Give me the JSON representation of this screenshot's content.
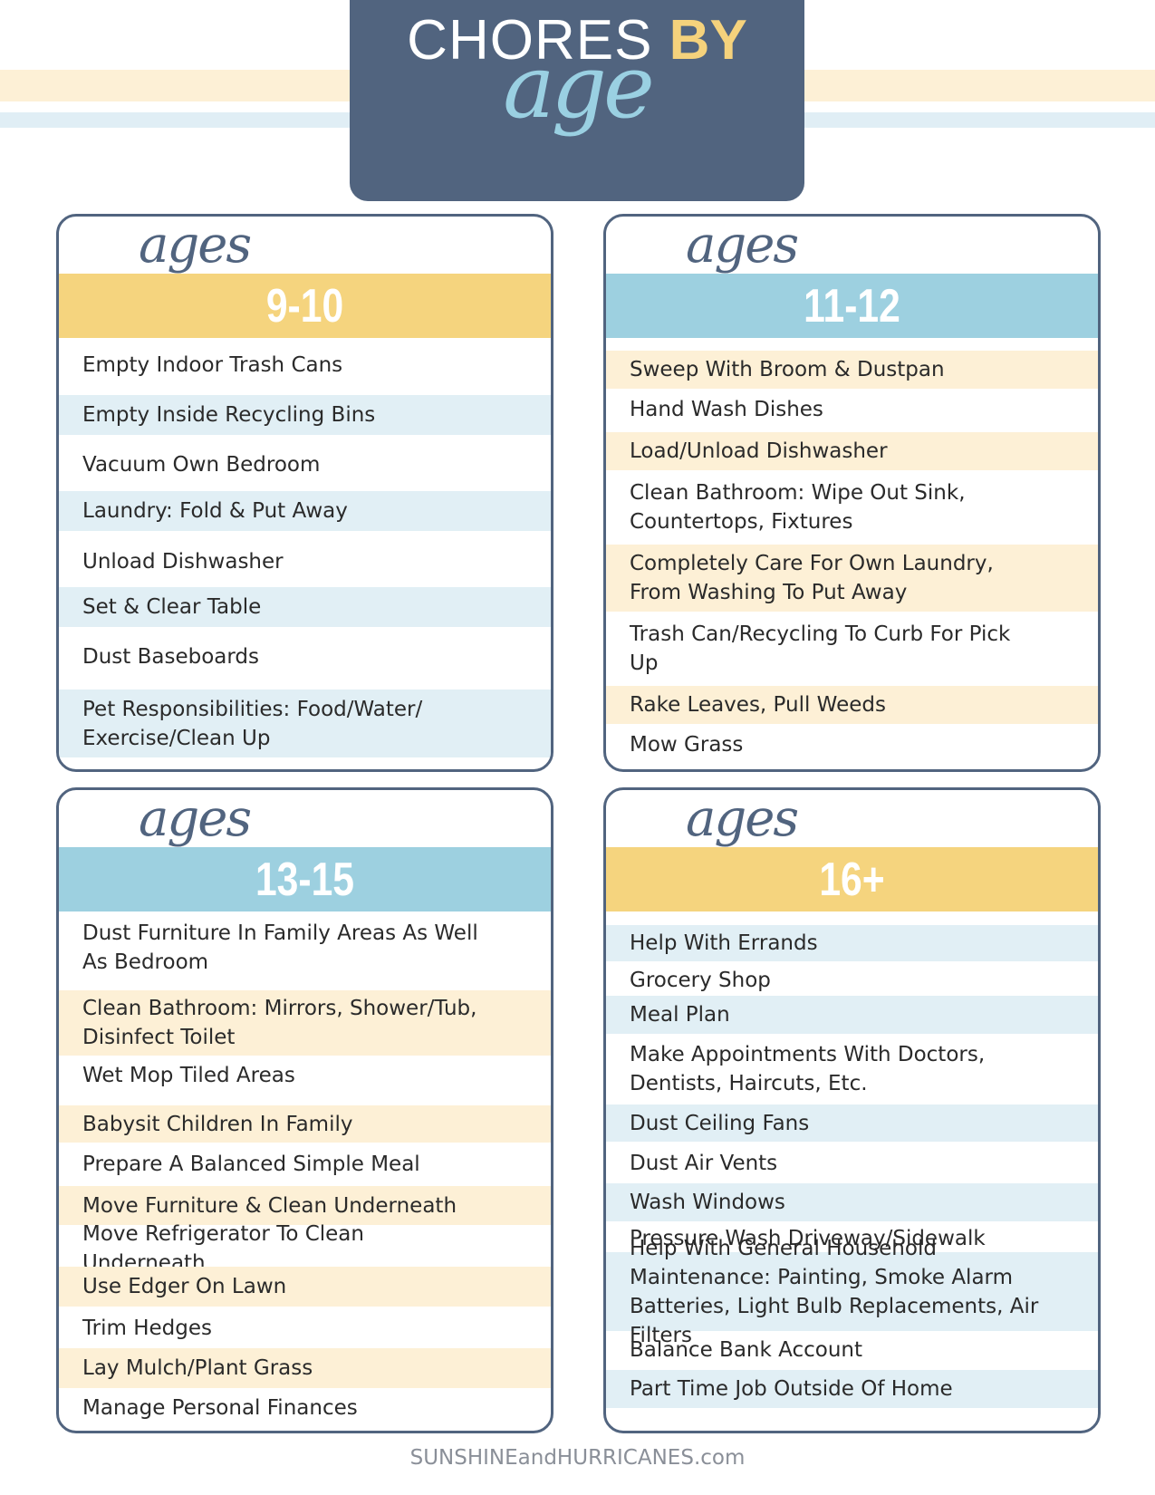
{
  "header": {
    "title_main": "CHORES",
    "title_accent": "BY",
    "title_script": "age"
  },
  "colors": {
    "navy": "#51647f",
    "yellow": "#f5d47e",
    "light_yellow": "#fdf0d6",
    "blue": "#9dd0e0",
    "light_blue": "#e1eff5",
    "script_blue": "#9ad0e2"
  },
  "cards": [
    {
      "label": "ages",
      "range": "9-10",
      "band_color": "yellow",
      "chores": [
        {
          "text": "Empty Indoor Trash Cans",
          "bg": "white"
        },
        {
          "text": "Empty Inside Recycling Bins",
          "bg": "blue"
        },
        {
          "text": "Vacuum Own Bedroom",
          "bg": "white"
        },
        {
          "text": "Laundry: Fold & Put Away",
          "bg": "blue"
        },
        {
          "text": "Unload Dishwasher",
          "bg": "white"
        },
        {
          "text": "Set & Clear Table",
          "bg": "blue"
        },
        {
          "text": "Dust Baseboards",
          "bg": "white"
        },
        {
          "text": "Pet Responsibilities: Food/Water/ Exercise/Clean Up",
          "bg": "blue"
        }
      ]
    },
    {
      "label": "ages",
      "range": "11-12",
      "band_color": "blue",
      "chores": [
        {
          "text": "Sweep With Broom & Dustpan",
          "bg": "yellow"
        },
        {
          "text": "Hand Wash Dishes",
          "bg": "white"
        },
        {
          "text": "Load/Unload Dishwasher",
          "bg": "yellow"
        },
        {
          "text": "Clean Bathroom: Wipe Out Sink, Countertops, Fixtures",
          "bg": "white"
        },
        {
          "text": "Completely Care For Own Laundry, From Washing To Put Away",
          "bg": "yellow"
        },
        {
          "text": "Trash Can/Recycling To Curb For Pick Up",
          "bg": "white"
        },
        {
          "text": "Rake Leaves, Pull Weeds",
          "bg": "yellow"
        },
        {
          "text": "Mow Grass",
          "bg": "white"
        }
      ]
    },
    {
      "label": "ages",
      "range": "13-15",
      "band_color": "blue",
      "chores": [
        {
          "text": "Dust Furniture In Family Areas As Well As Bedroom",
          "bg": "white"
        },
        {
          "text": "Clean Bathroom: Mirrors, Shower/Tub, Disinfect Toilet",
          "bg": "yellow"
        },
        {
          "text": "Wet Mop Tiled Areas",
          "bg": "white"
        },
        {
          "text": "Babysit Children In Family",
          "bg": "yellow"
        },
        {
          "text": "Prepare A Balanced Simple Meal",
          "bg": "white"
        },
        {
          "text": "Move Furniture & Clean Underneath",
          "bg": "yellow"
        },
        {
          "text": "Move Refrigerator To Clean Underneath",
          "bg": "white"
        },
        {
          "text": "Use Edger On Lawn",
          "bg": "yellow"
        },
        {
          "text": "Trim Hedges",
          "bg": "white"
        },
        {
          "text": "Lay Mulch/Plant Grass",
          "bg": "yellow"
        },
        {
          "text": "Manage Personal Finances",
          "bg": "white"
        }
      ]
    },
    {
      "label": "ages",
      "range": "16+",
      "band_color": "yellow",
      "chores": [
        {
          "text": "Help With Errands",
          "bg": "blue"
        },
        {
          "text": "Grocery Shop",
          "bg": "white"
        },
        {
          "text": "Meal Plan",
          "bg": "blue"
        },
        {
          "text": "Make Appointments With Doctors, Dentists, Haircuts, Etc.",
          "bg": "white"
        },
        {
          "text": "Dust Ceiling Fans",
          "bg": "blue"
        },
        {
          "text": "Dust Air Vents",
          "bg": "white"
        },
        {
          "text": "Wash Windows",
          "bg": "blue"
        },
        {
          "text": "Pressure Wash Driveway/Sidewalk",
          "bg": "white"
        },
        {
          "text": "Help With General Household Maintenance: Painting, Smoke Alarm Batteries, Light Bulb Replacements, Air Filters",
          "bg": "blue"
        },
        {
          "text": "Balance Bank Account",
          "bg": "white"
        },
        {
          "text": "Part Time Job Outside Of Home",
          "bg": "blue"
        }
      ]
    }
  ],
  "footer": {
    "site": "SUNSHINEandHURRICANES.com"
  }
}
